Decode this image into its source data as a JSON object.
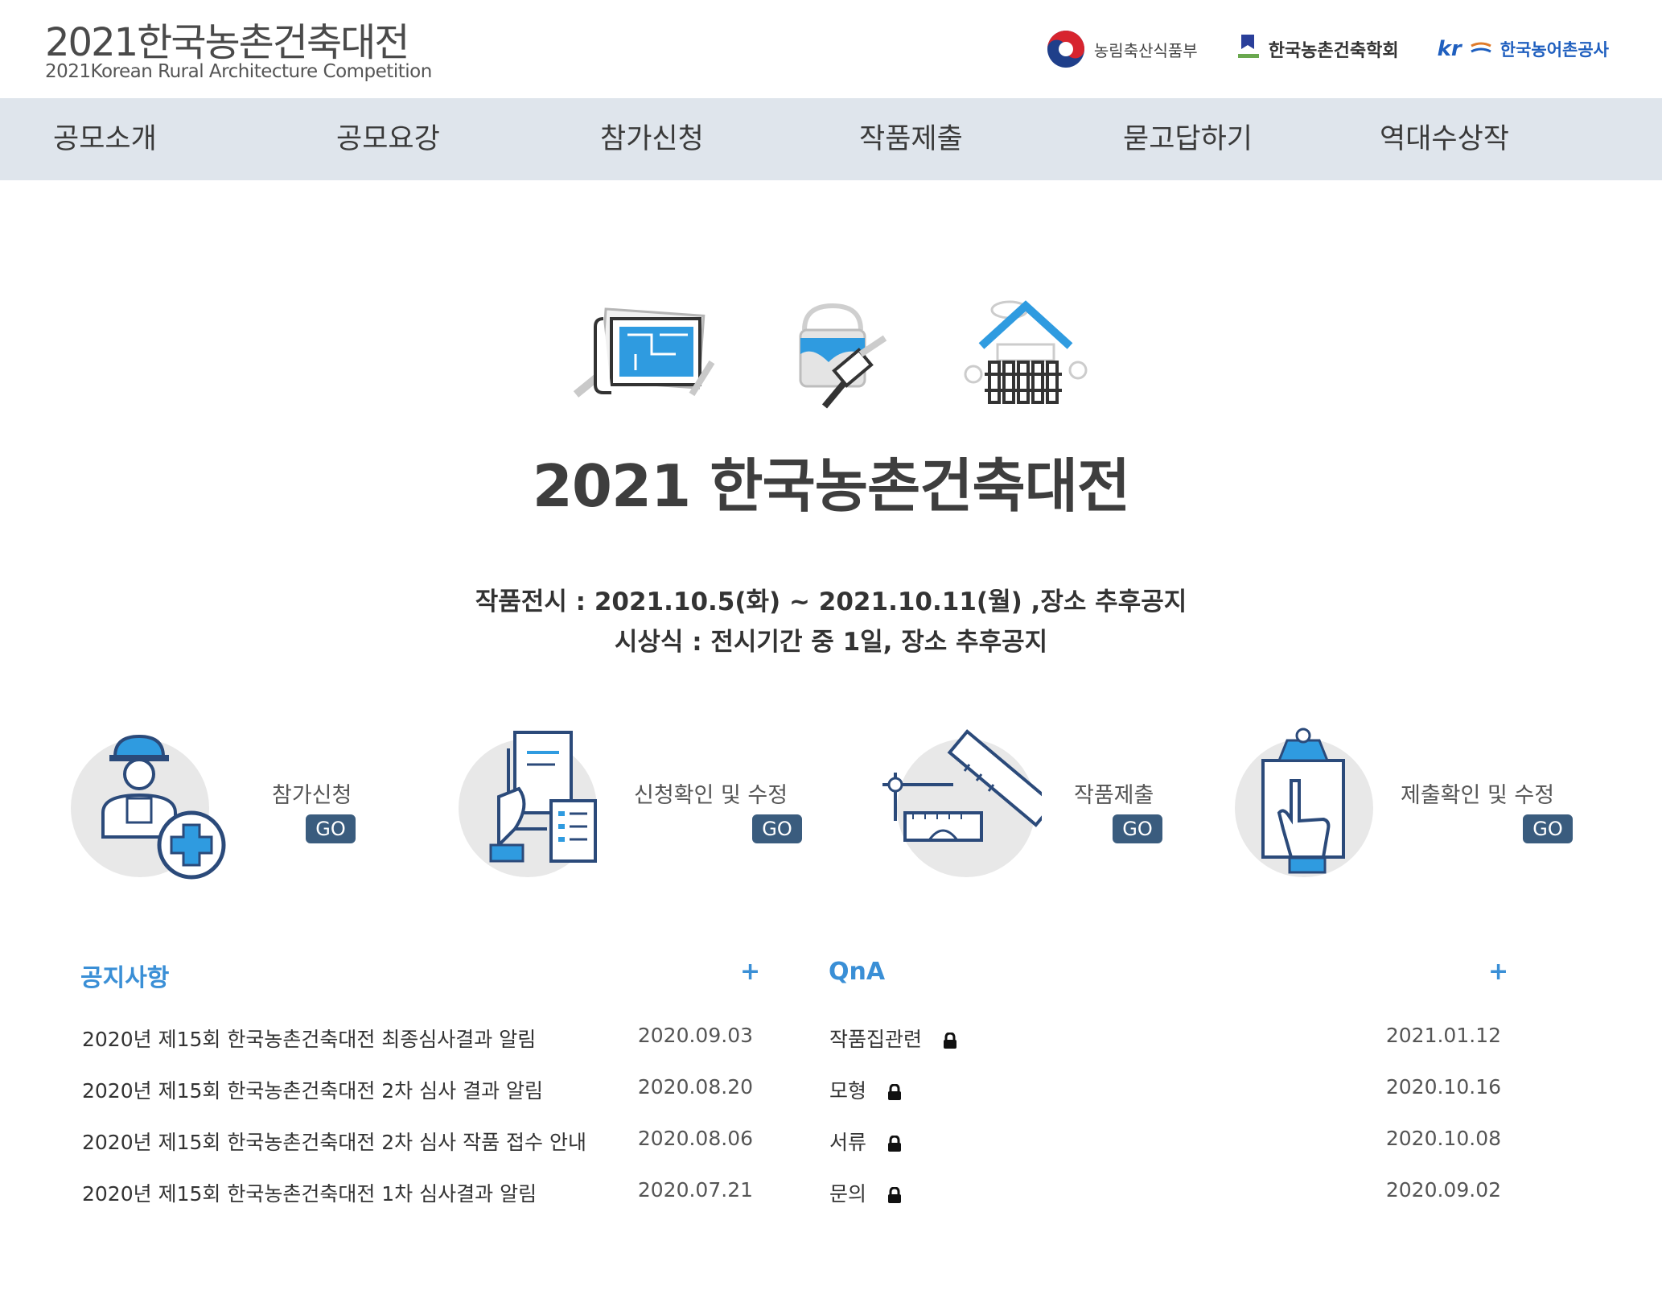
{
  "header": {
    "logo_title": "2021한국농촌건축대전",
    "logo_subtitle": "2021Korean Rural Architecture Competition",
    "partners": [
      {
        "name": "농림축산식품부",
        "icon": "taegeuk-emblem-icon"
      },
      {
        "name": "한국농촌건축학회",
        "icon": "kira-flag-icon"
      },
      {
        "name": "한국농어촌공사",
        "icon": "kfc-logo-icon",
        "mark": "kr"
      }
    ]
  },
  "nav": {
    "items": [
      "공모소개",
      "공모요강",
      "참가신청",
      "작품제출",
      "묻고답하기",
      "역대수상작"
    ]
  },
  "hero": {
    "title": "2021 한국농촌건축대전",
    "icons": [
      "blueprint-icon",
      "paint-bucket-brush-icon",
      "house-fence-icon"
    ],
    "info_line1": "작품전시 : 2021.10.5(화) ~ 2021.10.11(월) ,장소 추후공지",
    "info_line2": "시상식 : 전시기간 중 1일, 장소 추후공지"
  },
  "quick_menu": [
    {
      "label": "참가신청",
      "button": "GO",
      "icon": "worker-plus-icon"
    },
    {
      "label": "신청확인 및 수정",
      "button": "GO",
      "icon": "hand-document-icon"
    },
    {
      "label": "작품제출",
      "button": "GO",
      "icon": "ruler-tools-icon"
    },
    {
      "label": "제출확인 및 수정",
      "button": "GO",
      "icon": "clipboard-hand-icon"
    }
  ],
  "notice": {
    "title": "공지사항",
    "more": "+",
    "items": [
      {
        "title": "2020년 제15회 한국농촌건축대전 최종심사결과 알림",
        "date": "2020.09.03"
      },
      {
        "title": "2020년 제15회 한국농촌건축대전 2차 심사 결과 알림",
        "date": "2020.08.20"
      },
      {
        "title": "2020년 제15회 한국농촌건축대전 2차 심사 작품 접수 안내",
        "date": "2020.08.06"
      },
      {
        "title": "2020년 제15회 한국농촌건축대전 1차 심사결과 알림",
        "date": "2020.07.21"
      }
    ]
  },
  "qna": {
    "title": "QnA",
    "more": "+",
    "items": [
      {
        "title": "작품집관련",
        "date": "2021.01.12",
        "locked": true
      },
      {
        "title": "모형",
        "date": "2020.10.16",
        "locked": true
      },
      {
        "title": "서류",
        "date": "2020.10.08",
        "locked": true
      },
      {
        "title": "문의",
        "date": "2020.09.02",
        "locked": true
      }
    ]
  }
}
